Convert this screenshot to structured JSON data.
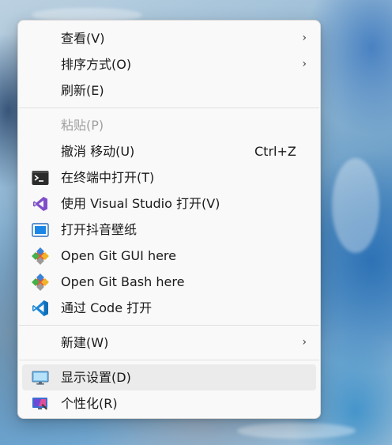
{
  "context_menu": {
    "items": [
      {
        "label": "查看(V)"
      },
      {
        "label": "排序方式(O)"
      },
      {
        "label": "刷新(E)"
      },
      {
        "label": "粘贴(P)"
      },
      {
        "label": "撤消 移动(U)",
        "shortcut": "Ctrl+Z"
      },
      {
        "label": "在终端中打开(T)",
        "icon": "terminal-icon"
      },
      {
        "label": "使用 Visual Studio 打开(V)",
        "icon": "visual-studio-icon"
      },
      {
        "label": "打开抖音壁纸",
        "icon": "wallpaper-app-icon"
      },
      {
        "label": "Open Git GUI here",
        "icon": "git-icon"
      },
      {
        "label": "Open Git Bash here",
        "icon": "git-icon"
      },
      {
        "label": "通过 Code 打开",
        "icon": "vscode-icon"
      },
      {
        "label": "新建(W)"
      },
      {
        "label": "显示设置(D)",
        "icon": "display-settings-icon"
      },
      {
        "label": "个性化(R)",
        "icon": "personalize-icon"
      }
    ],
    "submenu_glyph": "›"
  },
  "colors": {
    "menu_background": "#f9f9f9",
    "highlight": "#ebebeb",
    "text": "#1a1a1a",
    "disabled_text": "#a0a0a0",
    "separator": "#e1e1e1"
  }
}
